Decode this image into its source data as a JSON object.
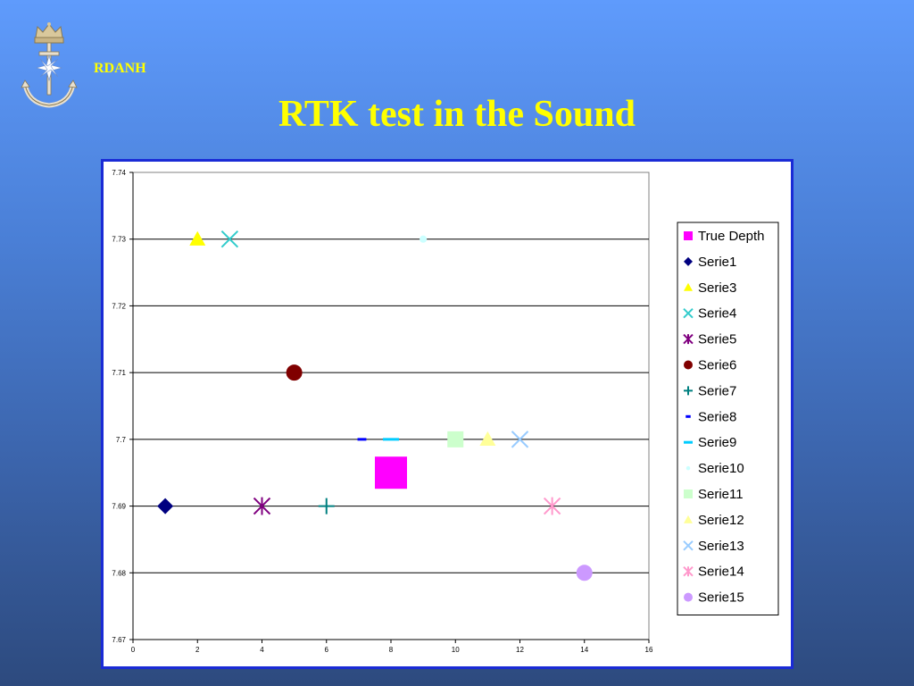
{
  "header": {
    "org": "RDANH",
    "title": "RTK test in the Sound",
    "logo_icon": "crowned-anchor-icon"
  },
  "chart_data": {
    "type": "scatter",
    "title": "",
    "xlabel": "",
    "ylabel": "",
    "xlim": [
      0,
      16
    ],
    "ylim": [
      7.67,
      7.74
    ],
    "x_ticks": [
      "0",
      "2",
      "4",
      "6",
      "8",
      "10",
      "12",
      "14",
      "16"
    ],
    "y_ticks": [
      "7.67",
      "7.68",
      "7.69",
      "7.7",
      "7.71",
      "7.72",
      "7.73",
      "7.74"
    ],
    "grid": "horizontal",
    "legend_position": "right",
    "series": [
      {
        "name": "True Depth",
        "marker": "square",
        "color": "#ff00ff",
        "points": [
          [
            8,
            7.695
          ]
        ]
      },
      {
        "name": "Serie1",
        "marker": "diamond",
        "color": "#000080",
        "points": [
          [
            1,
            7.69
          ]
        ]
      },
      {
        "name": "Serie3",
        "marker": "triangle",
        "color": "#ffff00",
        "points": [
          [
            2,
            7.73
          ]
        ]
      },
      {
        "name": "Serie4",
        "marker": "x",
        "color": "#33cccc",
        "points": [
          [
            3,
            7.73
          ]
        ]
      },
      {
        "name": "Serie5",
        "marker": "star",
        "color": "#800080",
        "points": [
          [
            4,
            7.69
          ]
        ]
      },
      {
        "name": "Serie6",
        "marker": "circle",
        "color": "#800000",
        "points": [
          [
            5,
            7.71
          ]
        ]
      },
      {
        "name": "Serie7",
        "marker": "plus",
        "color": "#008080",
        "points": [
          [
            6,
            7.69
          ]
        ]
      },
      {
        "name": "Serie8",
        "marker": "dash",
        "color": "#0000ff",
        "points": [
          [
            7.1,
            7.7
          ]
        ]
      },
      {
        "name": "Serie9",
        "marker": "longdash",
        "color": "#00ccff",
        "points": [
          [
            8,
            7.7
          ]
        ]
      },
      {
        "name": "Serie10",
        "marker": "circle-small",
        "color": "#ccffff",
        "points": [
          [
            9,
            7.73
          ]
        ]
      },
      {
        "name": "Serie11",
        "marker": "square",
        "color": "#ccffcc",
        "points": [
          [
            10,
            7.7
          ]
        ]
      },
      {
        "name": "Serie12",
        "marker": "triangle",
        "color": "#ffff99",
        "points": [
          [
            11,
            7.7
          ]
        ]
      },
      {
        "name": "Serie13",
        "marker": "x",
        "color": "#99ccff",
        "points": [
          [
            12,
            7.7
          ]
        ]
      },
      {
        "name": "Serie14",
        "marker": "star",
        "color": "#ff99cc",
        "points": [
          [
            13,
            7.69
          ]
        ]
      },
      {
        "name": "Serie15",
        "marker": "circle",
        "color": "#cc99ff",
        "points": [
          [
            14,
            7.68
          ]
        ]
      }
    ]
  }
}
